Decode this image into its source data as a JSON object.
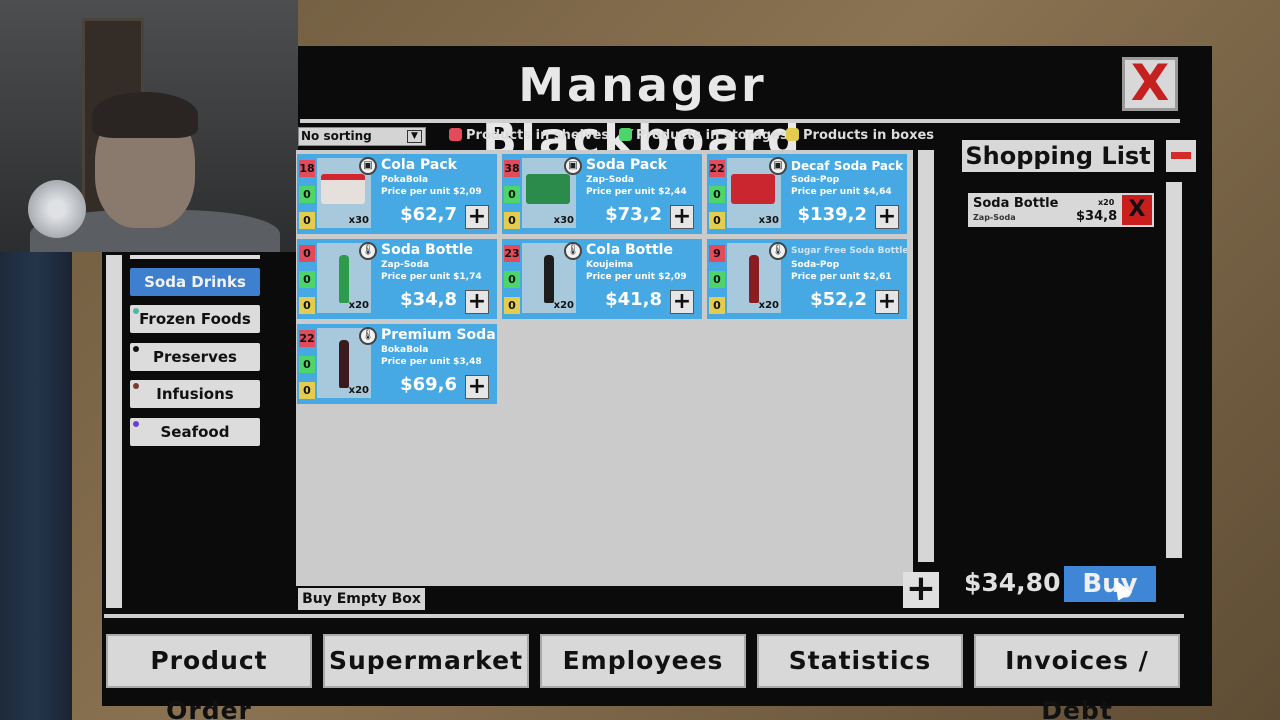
{
  "title": "Manager Blackboard",
  "close_label": "X",
  "filters": {
    "sort_value": "No sorting",
    "legend": [
      {
        "label": "Products in shelves",
        "color": "#e34b5a"
      },
      {
        "label": "Products in storages",
        "color": "#4ed56a"
      },
      {
        "label": "Products in boxes",
        "color": "#e3cc4e"
      }
    ]
  },
  "categories": [
    {
      "label": "Soda Drinks",
      "active": true,
      "dot": "#3e7fce"
    },
    {
      "label": "Frozen Foods",
      "active": false,
      "dot": "#4fb7a8"
    },
    {
      "label": "Preserves",
      "active": false,
      "dot": "#111111"
    },
    {
      "label": "Infusions",
      "active": false,
      "dot": "#7a3b2e"
    },
    {
      "label": "Seafood",
      "active": false,
      "dot": "#6b3fd4"
    }
  ],
  "products": [
    {
      "name": "Cola Pack",
      "brand": "PokaBola",
      "ppu": "Price per unit $2,09",
      "price": "$62,7",
      "shelves": "18",
      "storage": "0",
      "boxes": "0",
      "qty": "x30",
      "icon": "box-icon"
    },
    {
      "name": "Soda Pack",
      "brand": "Zap-Soda",
      "ppu": "Price per unit $2,44",
      "price": "$73,2",
      "shelves": "38",
      "storage": "0",
      "boxes": "0",
      "qty": "x30",
      "icon": "box-icon"
    },
    {
      "name": "Decaf Soda Pack",
      "brand": "Soda-Pop",
      "ppu": "Price per unit $4,64",
      "price": "$139,2",
      "shelves": "22",
      "storage": "0",
      "boxes": "0",
      "qty": "x30",
      "icon": "box-icon"
    },
    {
      "name": "Soda Bottle",
      "brand": "Zap-Soda",
      "ppu": "Price per unit $1,74",
      "price": "$34,8",
      "shelves": "0",
      "storage": "0",
      "boxes": "0",
      "qty": "x20",
      "icon": "thermometer-icon"
    },
    {
      "name": "Cola Bottle",
      "brand": "Koujeima",
      "ppu": "Price per unit $2,09",
      "price": "$41,8",
      "shelves": "23",
      "storage": "0",
      "boxes": "0",
      "qty": "x20",
      "icon": "thermometer-icon"
    },
    {
      "name": "Sugar Free Soda Bottle",
      "brand": "Soda-Pop",
      "ppu": "Price per unit $2,61",
      "price": "$52,2",
      "shelves": "9",
      "storage": "0",
      "boxes": "0",
      "qty": "x20",
      "icon": "thermometer-icon"
    },
    {
      "name": "Premium Soda",
      "brand": "BokaBola",
      "ppu": "Price per unit $3,48",
      "price": "$69,6",
      "shelves": "22",
      "storage": "0",
      "boxes": "0",
      "qty": "x20",
      "icon": "thermometer-icon"
    }
  ],
  "buy_empty_box": "Buy Empty Box",
  "shopping_list": {
    "title": "Shopping List",
    "items": [
      {
        "name": "Soda Bottle",
        "brand": "Zap-Soda",
        "qty": "x20",
        "price": "$34,8",
        "remove": "X"
      }
    ],
    "total": "$34,80",
    "buy": "Buy"
  },
  "nav": [
    "Product Order",
    "Supermarket",
    "Employees",
    "Statistics",
    "Invoices / Debt"
  ]
}
